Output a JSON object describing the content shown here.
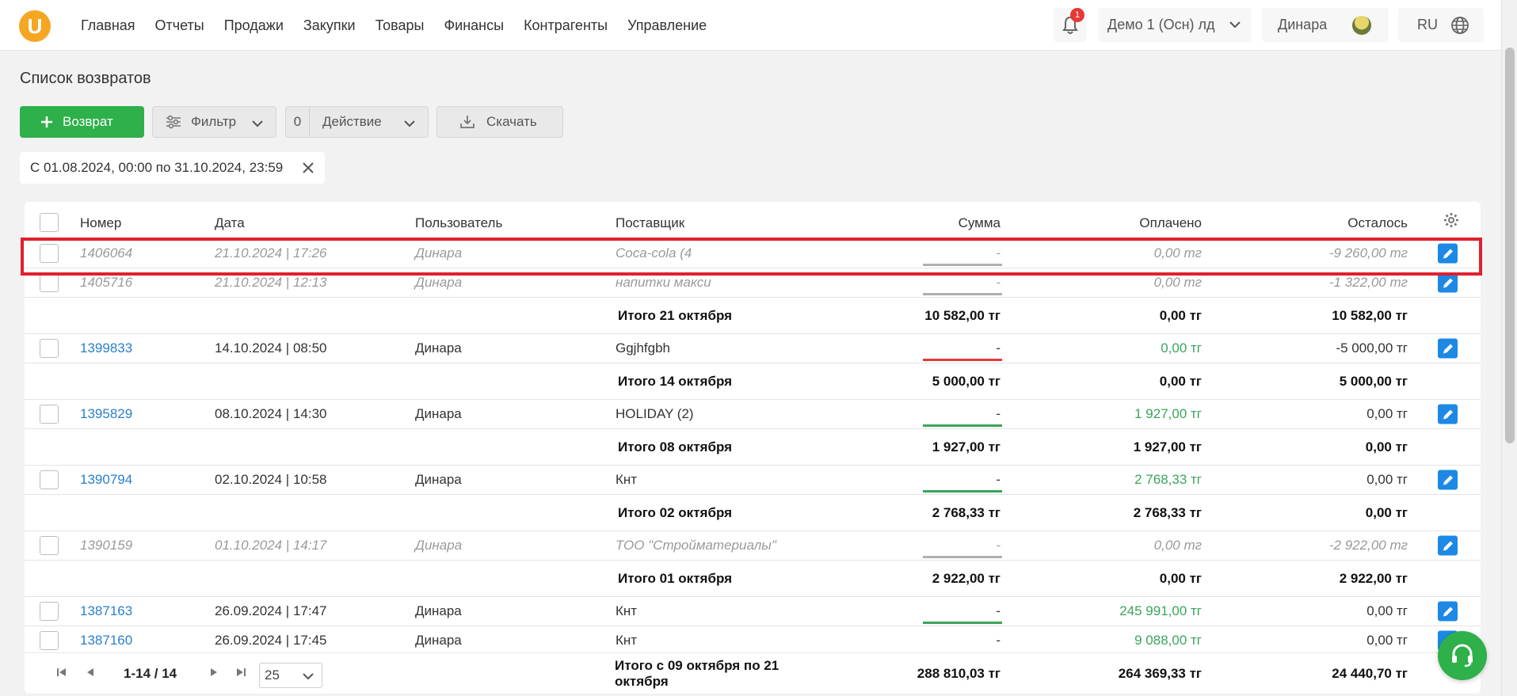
{
  "nav": {
    "logo": "U",
    "items": [
      "Главная",
      "Отчеты",
      "Продажи",
      "Закупки",
      "Товары",
      "Финансы",
      "Контрагенты",
      "Управление"
    ],
    "notifications": "1",
    "org": "Демо 1 (Осн) лд",
    "user": "Динара",
    "lang": "RU"
  },
  "page": {
    "title": "Список возвратов"
  },
  "toolbar": {
    "add_label": "Возврат",
    "filter_label": "Фильтр",
    "action_count": "0",
    "action_label": "Действие",
    "download_label": "Скачать"
  },
  "filter_chip": {
    "text": "С 01.08.2024, 00:00 по 31.10.2024, 23:59"
  },
  "table": {
    "headers": {
      "num": "Номер",
      "date": "Дата",
      "user": "Пользователь",
      "supplier": "Поставщик",
      "sum": "Сумма",
      "paid": "Оплачено",
      "left": "Осталось"
    },
    "rows": [
      {
        "num": "1406064",
        "date": "21.10.2024 | 17:26",
        "user": "Динара",
        "supplier": "Coca-cola (4",
        "sum": "-",
        "paid": "0,00 тг",
        "left": "-9 260,00 тг"
      },
      {
        "num": "1405716",
        "date": "21.10.2024 | 12:13",
        "user": "Динара",
        "supplier": "напитки макси",
        "sum": "-",
        "paid": "0,00 тг",
        "left": "-1 322,00 тг"
      },
      {
        "total_label": "Итого 21 октября",
        "sum": "10 582,00 тг",
        "paid": "0,00 тг",
        "left": "10 582,00 тг"
      },
      {
        "num": "1399833",
        "date": "14.10.2024 | 08:50",
        "user": "Динара",
        "supplier": "Ggjhfgbh",
        "sum": "-",
        "paid": "0,00 тг",
        "left": "-5 000,00 тг"
      },
      {
        "total_label": "Итого 14 октября",
        "sum": "5 000,00 тг",
        "paid": "0,00 тг",
        "left": "5 000,00 тг"
      },
      {
        "num": "1395829",
        "date": "08.10.2024 | 14:30",
        "user": "Динара",
        "supplier": "HOLIDAY (2)",
        "sum": "-",
        "paid": "1 927,00 тг",
        "left": "0,00 тг"
      },
      {
        "total_label": "Итого 08 октября",
        "sum": "1 927,00 тг",
        "paid": "1 927,00 тг",
        "left": "0,00 тг"
      },
      {
        "num": "1390794",
        "date": "02.10.2024 | 10:58",
        "user": "Динара",
        "supplier": "Кнт",
        "sum": "-",
        "paid": "2 768,33 тг",
        "left": "0,00 тг"
      },
      {
        "total_label": "Итого 02 октября",
        "sum": "2 768,33 тг",
        "paid": "2 768,33 тг",
        "left": "0,00 тг"
      },
      {
        "num": "1390159",
        "date": "01.10.2024 | 14:17",
        "user": "Динара",
        "supplier": "ТОО \"Стройматериалы\"",
        "sum": "-",
        "paid": "0,00 тг",
        "left": "-2 922,00 тг"
      },
      {
        "total_label": "Итого 01 октября",
        "sum": "2 922,00 тг",
        "paid": "0,00 тг",
        "left": "2 922,00 тг"
      },
      {
        "num": "1387163",
        "date": "26.09.2024 | 17:47",
        "user": "Динара",
        "supplier": "Кнт",
        "sum": "-",
        "paid": "245 991,00 тг",
        "left": "0,00 тг"
      },
      {
        "num": "1387160",
        "date": "26.09.2024 | 17:45",
        "user": "Динара",
        "supplier": "Кнт",
        "sum": "-",
        "paid": "9 088,00 тг",
        "left": "0,00 тг"
      }
    ]
  },
  "pager": {
    "range": "1-14 / 14",
    "page_size": "25",
    "total_label": "Итого с 09 октября по 21 октября",
    "total_sum": "288 810,03 тг",
    "total_paid": "264 369,33 тг",
    "total_left": "24 440,70 тг"
  },
  "colors": {
    "accent_green": "#2eb04a",
    "link_blue": "#2a7fd0",
    "highlight_red": "#e0202e",
    "bar_red": "#e53935",
    "bar_gray": "#b0b0b0"
  }
}
